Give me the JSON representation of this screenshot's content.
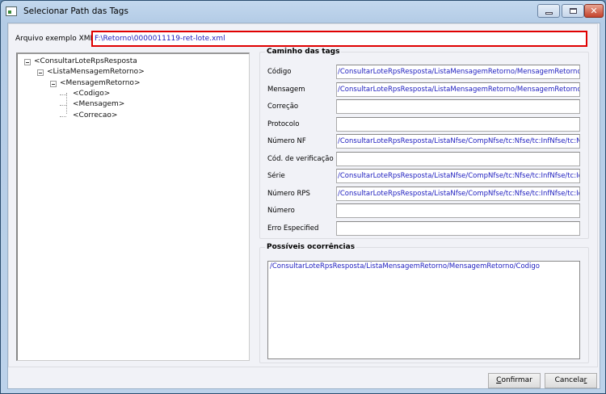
{
  "window": {
    "title": "Selecionar Path das Tags",
    "controls": [
      "minimize",
      "maximize",
      "close"
    ],
    "close_glyph": "✕"
  },
  "file": {
    "label": "Arquivo exemplo XML",
    "value": "F:\\Retorno\\0000011119-ret-lote.xml"
  },
  "tree": {
    "nodes": [
      {
        "label": "<ConsultarLoteRpsResposta",
        "level": 0,
        "expanded": true
      },
      {
        "label": "<ListaMensagemRetorno>",
        "level": 1,
        "expanded": true
      },
      {
        "label": "<MensagemRetorno>",
        "level": 2,
        "expanded": true
      },
      {
        "label": "<Codigo>",
        "level": 3
      },
      {
        "label": "<Mensagem>",
        "level": 3
      },
      {
        "label": "<Correcao>",
        "level": 3
      }
    ]
  },
  "paths": {
    "title": "Caminho das tags",
    "fields": [
      {
        "label": "Código",
        "value": "/ConsultarLoteRpsResposta/ListaMensagemRetorno/MensagemRetorno/tc:"
      },
      {
        "label": "Mensagem",
        "value": "/ConsultarLoteRpsResposta/ListaMensagemRetorno/MensagemRetorno/tc:"
      },
      {
        "label": "Correção",
        "value": ""
      },
      {
        "label": "Protocolo",
        "value": ""
      },
      {
        "label": "Número NF",
        "value": "/ConsultarLoteRpsResposta/ListaNfse/CompNfse/tc:Nfse/tc:InfNfse/tc:Nur"
      },
      {
        "label": "Cód. de verificação",
        "value": ""
      },
      {
        "label": "Série",
        "value": "/ConsultarLoteRpsResposta/ListaNfse/CompNfse/tc:Nfse/tc:InfNfse/tc:Ide"
      },
      {
        "label": "Número RPS",
        "value": "/ConsultarLoteRpsResposta/ListaNfse/CompNfse/tc:Nfse/tc:InfNfse/tc:Ide"
      },
      {
        "label": "Número",
        "value": ""
      },
      {
        "label": "Erro Especified",
        "value": ""
      }
    ]
  },
  "occurrences": {
    "title": "Possíveis ocorrências",
    "items": [
      "/ConsultarLoteRpsResposta/ListaMensagemRetorno/MensagemRetorno/Codigo"
    ]
  },
  "buttons": {
    "confirm": {
      "pre": "",
      "accel": "C",
      "post": "onfirmar"
    },
    "cancel": {
      "pre": "Cancela",
      "accel": "r",
      "post": ""
    }
  }
}
